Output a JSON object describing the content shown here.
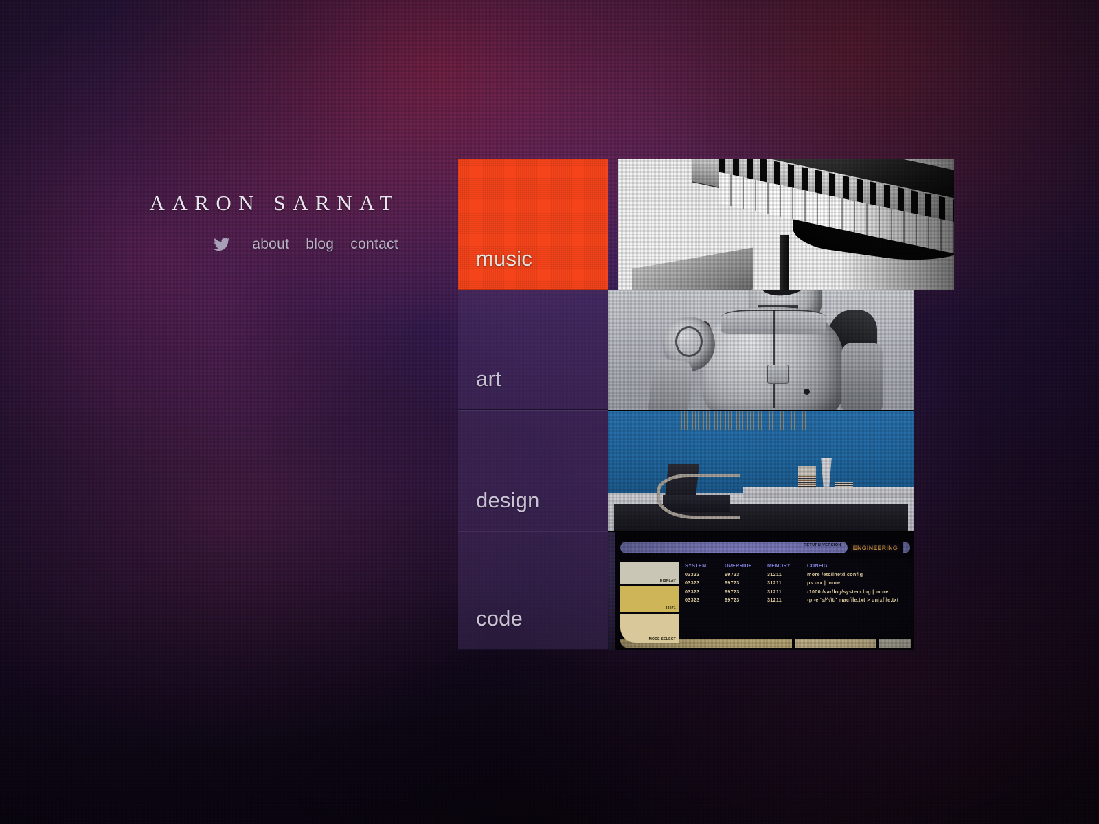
{
  "brand": {
    "title": "AARON SARNAT",
    "nav": {
      "twitter_icon": "twitter-bird-icon",
      "items": [
        {
          "label": "about"
        },
        {
          "label": "blog"
        },
        {
          "label": "contact"
        }
      ]
    }
  },
  "theme": {
    "accent": "#f5441a",
    "tile_bg": "rgba(74,52,104,0.42)",
    "label_color": "#c8c2d4",
    "background": "#2a1640"
  },
  "tiles": [
    {
      "label": "music",
      "active": true,
      "thumb_name": "piano-keyboard-photo",
      "thumb_alt": "black and white grand piano keyboard"
    },
    {
      "label": "art",
      "active": false,
      "thumb_name": "robot-render-image",
      "thumb_alt": "3d rendered humanoid robot torso"
    },
    {
      "label": "design",
      "active": false,
      "thumb_name": "interior-render-image",
      "thumb_alt": "modern interior with blue wall and armchair"
    },
    {
      "label": "code",
      "active": false,
      "thumb_name": "lcars-console-image",
      "thumb_alt": "lcars style console interface"
    }
  ],
  "code_panel": {
    "topbar": {
      "pill_label": "RETURN  VERSION",
      "section_label": "ENGINEERING"
    },
    "side_buttons": [
      {
        "label": "DISPLAY"
      },
      {
        "label": "33271"
      },
      {
        "label": "MODE SELECT"
      }
    ],
    "table": {
      "headers": [
        "SYSTEM",
        "OVERRIDE",
        "MEMORY",
        "CONFIG"
      ],
      "rows": [
        [
          "03323",
          "99723",
          "31211",
          "more /etc/inetd.config"
        ],
        [
          "03323",
          "99723",
          "31211",
          "ps -ax | more"
        ],
        [
          "03323",
          "99723",
          "31211",
          "-1000 /var/log/system.log | more"
        ],
        [
          "03323",
          "99723",
          "31211",
          "-p -e 's/^/\\t/' macfile.txt > unixfile.txt"
        ]
      ]
    }
  }
}
